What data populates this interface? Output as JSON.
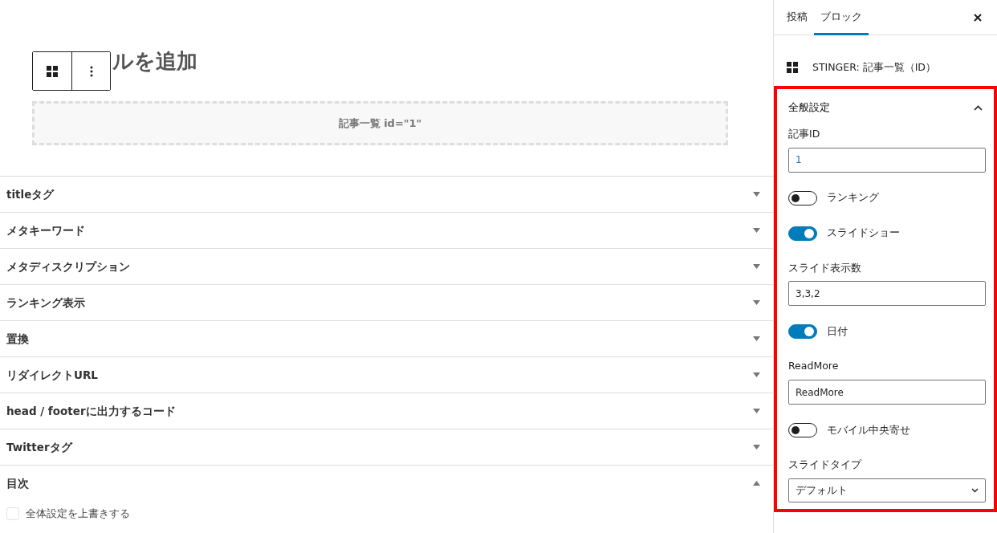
{
  "editor": {
    "heading": "ルを追加",
    "block_placeholder": "記事一覧 id=\"1\""
  },
  "meta_sections": [
    {
      "title": "titleタグ",
      "expanded": false
    },
    {
      "title": "メタキーワード",
      "expanded": false
    },
    {
      "title": "メタディスクリプション",
      "expanded": false
    },
    {
      "title": "ランキング表示",
      "expanded": false
    },
    {
      "title": "置換",
      "expanded": false
    },
    {
      "title": "リダイレクトURL",
      "expanded": false
    },
    {
      "title": "head / footerに出力するコード",
      "expanded": false
    },
    {
      "title": "Twitterタグ",
      "expanded": false
    },
    {
      "title": "目次",
      "expanded": true
    }
  ],
  "toc_option": {
    "label": "全体設定を上書きする",
    "checked": false
  },
  "sidebar": {
    "tabs": [
      {
        "label": "投稿",
        "selected": false
      },
      {
        "label": "ブロック",
        "selected": true
      }
    ],
    "block_name": "STINGER: 記事一覧（ID）",
    "panel": {
      "title": "全般設定",
      "expanded": true,
      "highlighted": true,
      "controls": [
        {
          "kind": "text",
          "label": "記事ID",
          "value": "1"
        },
        {
          "kind": "toggle",
          "label": "ランキング",
          "on": false
        },
        {
          "kind": "toggle",
          "label": "スライドショー",
          "on": true
        },
        {
          "kind": "text",
          "label": "スライド表示数",
          "value": "3,3,2"
        },
        {
          "kind": "toggle",
          "label": "日付",
          "on": true
        },
        {
          "kind": "text",
          "label": "ReadMore",
          "value": "ReadMore"
        },
        {
          "kind": "toggle",
          "label": "モバイル中央寄せ",
          "on": false
        },
        {
          "kind": "select",
          "label": "スライドタイプ",
          "value": "デフォルト"
        }
      ]
    }
  }
}
